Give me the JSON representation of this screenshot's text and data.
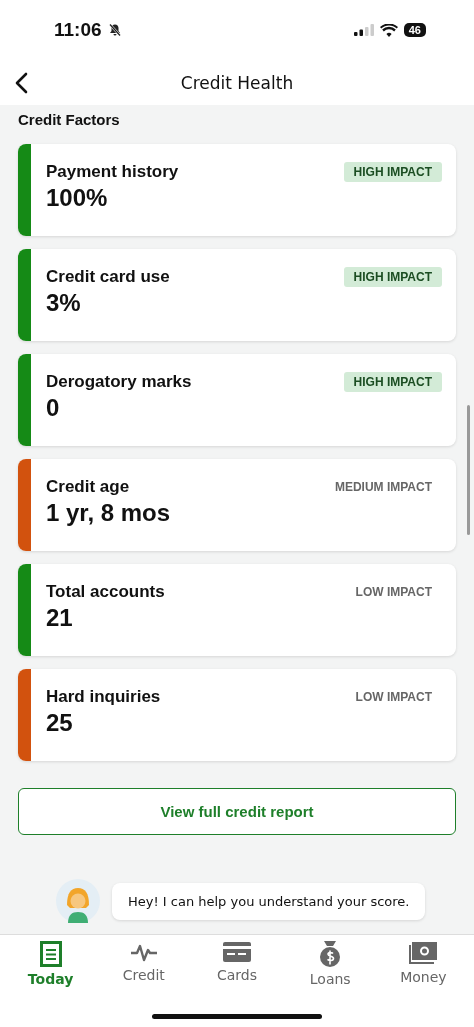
{
  "status_bar": {
    "time": "11:06",
    "battery": "46"
  },
  "header": {
    "title": "Credit Health"
  },
  "section_title": "Credit Factors",
  "factors": [
    {
      "name": "Payment history",
      "value": "100%",
      "impact": "HIGH IMPACT",
      "kind": "high",
      "color": "#158a16"
    },
    {
      "name": "Credit card use",
      "value": "3%",
      "impact": "HIGH IMPACT",
      "kind": "high",
      "color": "#158a16"
    },
    {
      "name": "Derogatory marks",
      "value": "0",
      "impact": "HIGH IMPACT",
      "kind": "high",
      "color": "#158a16"
    },
    {
      "name": "Credit age",
      "value": "1 yr, 8 mos",
      "impact": "MEDIUM IMPACT",
      "kind": "medium",
      "color": "#d2520e"
    },
    {
      "name": "Total accounts",
      "value": "21",
      "impact": "LOW IMPACT",
      "kind": "low",
      "color": "#158a16"
    },
    {
      "name": "Hard inquiries",
      "value": "25",
      "impact": "LOW IMPACT",
      "kind": "low",
      "color": "#d2520e"
    }
  ],
  "report_button": "View full credit report",
  "assistant_message": "Hey! I can help you understand your score.",
  "tabs": [
    {
      "label": "Today",
      "kind": "today",
      "selected": true
    },
    {
      "label": "Credit",
      "kind": "credit",
      "selected": false
    },
    {
      "label": "Cards",
      "kind": "cards",
      "selected": false
    },
    {
      "label": "Loans",
      "kind": "loans",
      "selected": false
    },
    {
      "label": "Money",
      "kind": "money",
      "selected": false
    }
  ]
}
